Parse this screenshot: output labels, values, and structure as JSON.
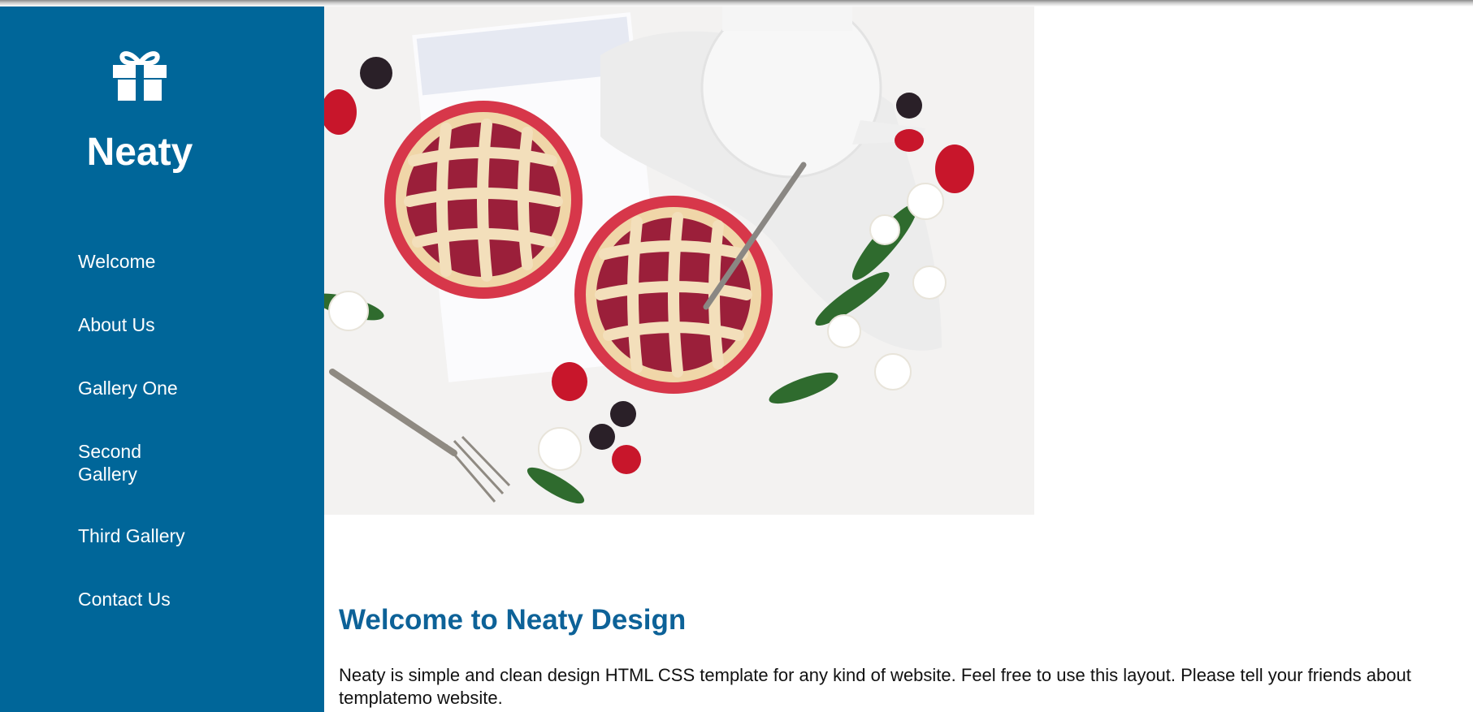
{
  "brand": {
    "name": "Neaty",
    "logo_icon": "gift-icon",
    "sidebar_color": "#006699"
  },
  "nav": {
    "items": [
      {
        "label": "Welcome"
      },
      {
        "label": "About Us"
      },
      {
        "label": "Gallery One"
      },
      {
        "label": "Second Gallery"
      },
      {
        "label": "Third Gallery"
      },
      {
        "label": "Contact Us"
      }
    ]
  },
  "hero": {
    "image_subject": "berry pies, teapot, fork and flowers on white table"
  },
  "content": {
    "heading": "Welcome to Neaty Design",
    "heading_color": "#0d6298",
    "paragraph": "Neaty is simple and clean design HTML CSS template for any kind of website. Feel free to use this layout. Please tell your friends about templatemo website."
  }
}
